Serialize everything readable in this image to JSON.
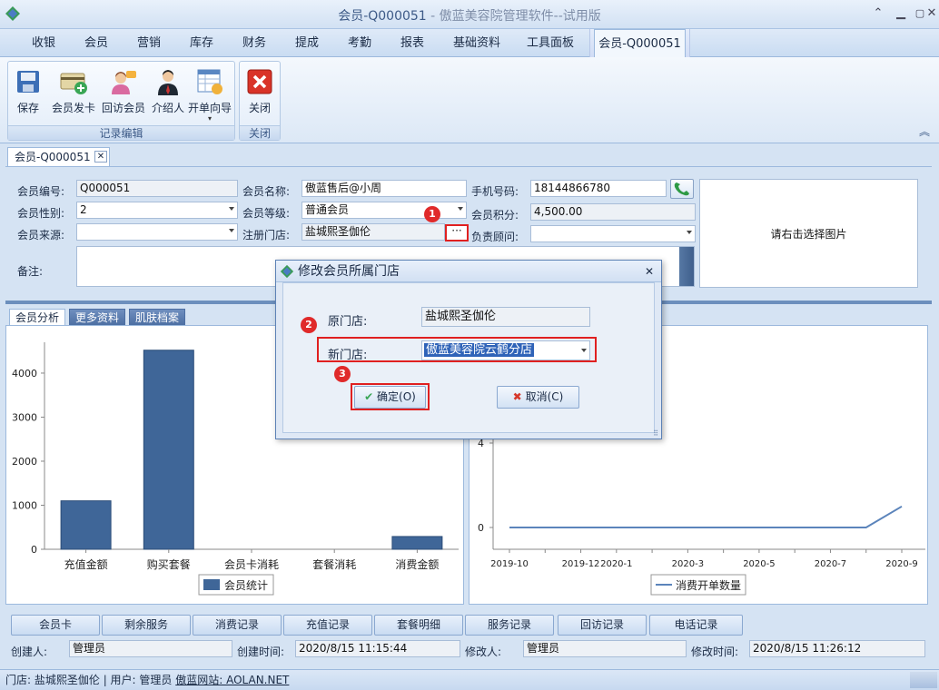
{
  "window": {
    "title": "会员-Q000051",
    "subtitle": " - 傲蓝美容院管理软件--试用版"
  },
  "menu": {
    "tabs": [
      "收银",
      "会员",
      "营销",
      "库存",
      "财务",
      "提成",
      "考勤",
      "报表",
      "基础资料",
      "工具面板",
      "会员-Q000051"
    ]
  },
  "ribbon": {
    "group1": {
      "label": "记录编辑",
      "buttons": [
        "保存",
        "会员发卡",
        "回访会员",
        "介绍人",
        "开单向导"
      ]
    },
    "group2": {
      "label": "关闭",
      "buttons": [
        "关闭"
      ]
    }
  },
  "doc_tab": {
    "label": "会员-Q000051",
    "close": "✕"
  },
  "form": {
    "member_no_label": "会员编号:",
    "member_no": "Q000051",
    "member_name_label": "会员名称:",
    "member_name": "傲蓝售后@小周",
    "phone_label": "手机号码:",
    "phone": "18144866780",
    "gender_label": "会员性别:",
    "gender": "2",
    "level_label": "会员等级:",
    "level": "普通会员",
    "points_label": "会员积分:",
    "points": "4,500.00",
    "source_label": "会员来源:",
    "source": "",
    "store_label": "注册门店:",
    "store": "盐城熙圣伽伦",
    "advisor_label": "负责顾问:",
    "advisor": "",
    "remark_label": "备注:",
    "photo_hint": "请右击选择图片",
    "store_button": "···"
  },
  "badges": [
    "1",
    "2",
    "3"
  ],
  "subtabs": [
    "会员分析",
    "更多资料",
    "肌肤档案"
  ],
  "chart_left": {
    "chart_data": {
      "type": "bar",
      "categories": [
        "充值金额",
        "购买套餐",
        "会员卡消耗",
        "套餐消耗",
        "消费金额"
      ],
      "series": [
        {
          "name": "会员统计",
          "values": [
            1100,
            4520,
            0,
            0,
            290
          ]
        }
      ],
      "yticks": [
        "0",
        "1000",
        "2000",
        "3000",
        "4000"
      ],
      "ylim": [
        0,
        4700
      ],
      "color": "#3f6698"
    }
  },
  "chart_right": {
    "chart_data": {
      "type": "line",
      "x": [
        "2019-10",
        "2019-11",
        "2019-12",
        "2020-1",
        "2020-2",
        "2020-3",
        "2020-4",
        "2020-5",
        "2020-6",
        "2020-7",
        "2020-8",
        "2020-9"
      ],
      "xticks": [
        "2019-10",
        "2019-12",
        "2020-1",
        "2020-3",
        "2020-5",
        "2020-7",
        "2020-9"
      ],
      "series": [
        {
          "name": "消费开单数量",
          "values": [
            0,
            0,
            0,
            0,
            0,
            0,
            0,
            0,
            0,
            0,
            0,
            1
          ]
        }
      ],
      "yticks": [
        "0",
        "4"
      ],
      "color": "#5b84bb"
    }
  },
  "bottom_buttons": [
    "会员卡",
    "剩余服务",
    "消费记录",
    "充值记录",
    "套餐明细",
    "服务记录",
    "回访记录",
    "电话记录"
  ],
  "info": {
    "creator_label": "创建人:",
    "creator": "管理员",
    "created_label": "创建时间:",
    "created": "2020/8/15 11:15:44",
    "modifier_label": "修改人:",
    "modifier": "管理员",
    "modified_label": "修改时间:",
    "modified": "2020/8/15 11:26:12"
  },
  "status": {
    "store": "门店: 盐城熙圣伽伦",
    "user": "| 用户: 管理员",
    "site": "傲蓝网站: AOLAN.NET"
  },
  "dialog": {
    "title": "修改会员所属门店",
    "old_store_label": "原门店:",
    "old_store": "盐城熙圣伽伦",
    "new_store_label": "新门店:",
    "new_store": "傲蓝美容院云鹤分店",
    "ok": "确定(O)",
    "cancel": "取消(C)",
    "close": "✕"
  },
  "colors": {
    "accent": "#3f6698",
    "badge": "#e02a2a",
    "frame": "#d5e3f3"
  }
}
